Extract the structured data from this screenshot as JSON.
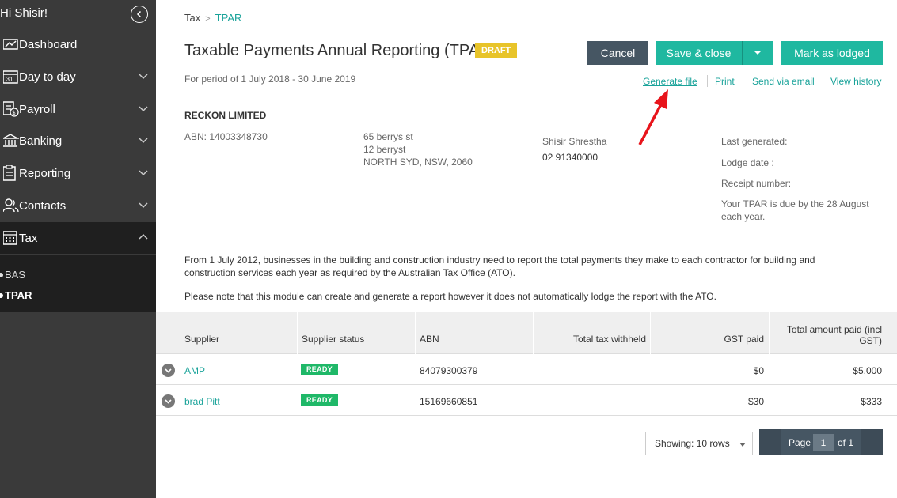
{
  "sidebar": {
    "greeting": "Hi Shisir!",
    "items": [
      {
        "label": "Dashboard",
        "icon": "dashboard-icon"
      },
      {
        "label": "Day to day",
        "icon": "calendar-icon"
      },
      {
        "label": "Payroll",
        "icon": "payroll-icon"
      },
      {
        "label": "Banking",
        "icon": "bank-icon"
      },
      {
        "label": "Reporting",
        "icon": "report-icon"
      },
      {
        "label": "Contacts",
        "icon": "contacts-icon"
      },
      {
        "label": "Tax",
        "icon": "calculator-icon"
      }
    ],
    "calendar_day": "31",
    "tax_sub": [
      "BAS",
      "TPAR"
    ]
  },
  "breadcrumb": {
    "parent": "Tax",
    "current": "TPAR"
  },
  "header": {
    "title": "Taxable Payments Annual Reporting (TPAR)",
    "badge": "DRAFT",
    "period": "For period of 1 July 2018 - 30 June 2019"
  },
  "actions": {
    "cancel": "Cancel",
    "save_close": "Save & close",
    "mark_lodged": "Mark as lodged",
    "links": [
      "Generate file",
      "Print",
      "Send via email",
      "View history"
    ]
  },
  "company": {
    "name": "RECKON LIMITED",
    "abn": "ABN: 14003348730",
    "address": [
      "65 berrys st",
      "12 berryst",
      "NORTH SYD, NSW, 2060"
    ],
    "contact_name": "Shisir Shrestha",
    "phone": "02 91340000",
    "last_generated": "Last generated:",
    "lodge_date": "Lodge date :",
    "receipt": "Receipt number:",
    "due": [
      "Your TPAR is due by the 28 August",
      "each year."
    ]
  },
  "description": {
    "para1_line1": "From 1 July 2012, businesses in the building and construction industry need to report the total payments they make to each contractor for building and",
    "para1_line2": "construction services each year as required by the Australian Tax Office (ATO).",
    "para2": "Please note that this module can create and generate a report however it does not automatically lodge the report with the ATO."
  },
  "table": {
    "columns": [
      "Supplier",
      "Supplier status",
      "ABN",
      "Total tax withheld",
      "GST paid",
      "Total amount paid (incl",
      "GST)"
    ],
    "rows": [
      {
        "supplier": "AMP",
        "status": "READY",
        "abn": "84079300379",
        "tax_withheld": "",
        "gst_paid": "$0",
        "total": "$5,000"
      },
      {
        "supplier": "brad Pitt",
        "status": "READY",
        "abn": "15169660851",
        "tax_withheld": "",
        "gst_paid": "$30",
        "total": "$333"
      }
    ]
  },
  "pagination": {
    "showing": "Showing: 10 rows",
    "page_label": "Page",
    "page_num": "1",
    "of_label": "of 1"
  },
  "colors": {
    "accent": "#1fb8a0",
    "sidebar": "#3a3a3a",
    "draft": "#e8c42a",
    "ready": "#1fb868",
    "arrow": "#e8141b"
  }
}
